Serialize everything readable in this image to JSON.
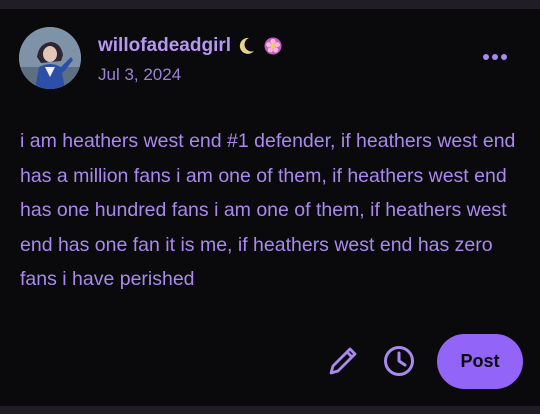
{
  "post": {
    "author": "willofadeadgirl",
    "date": "Jul 3, 2024",
    "body": "i am heathers west end #1 defender, if heathers west end has a million fans i am one of them, if heathers west end has one hundred fans i am one of them, if heathers west end has one fan it is me, if heathers west end has zero fans i have perished"
  },
  "badges": [
    "crescent-moon-icon",
    "flower-badge-icon"
  ],
  "toolbar": {
    "post_label": "Post",
    "icons": [
      "pencil-icon",
      "clock-icon",
      "more-dots-icon"
    ]
  },
  "colors": {
    "background": "#0a090c",
    "text": "#a989ef",
    "accent": "#9264f7"
  }
}
